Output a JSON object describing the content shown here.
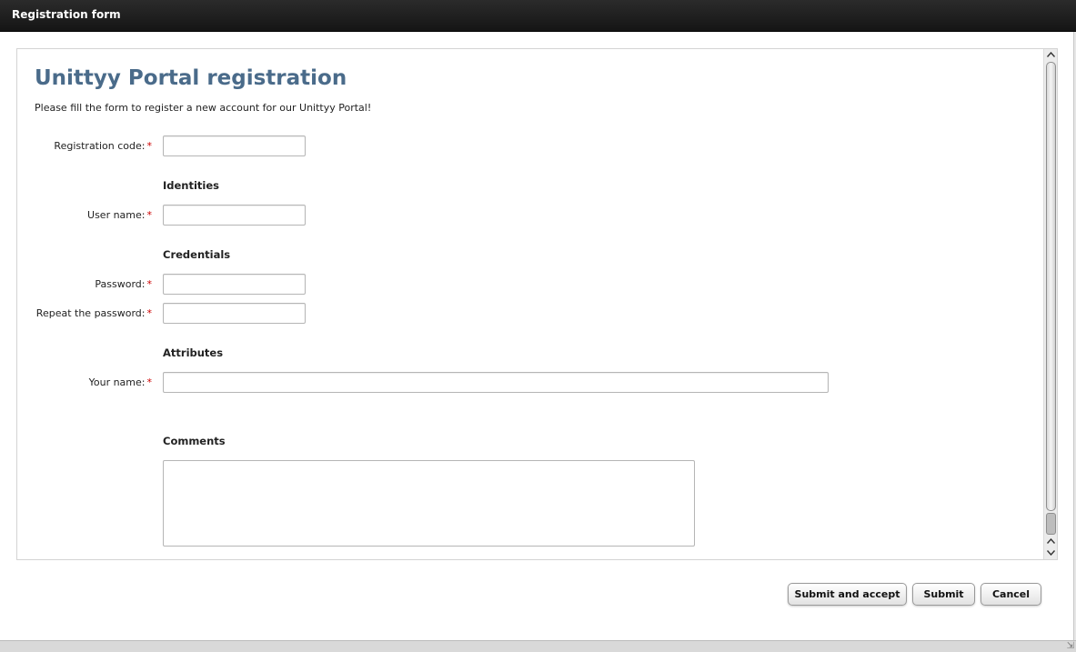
{
  "window": {
    "title": "Registration form"
  },
  "form": {
    "title": "Unittyy Portal registration",
    "intro": "Please fill the form to register a new account for our Unittyy Portal!",
    "required_marker": "*",
    "fields": {
      "registration_code": {
        "label": "Registration code:",
        "value": ""
      },
      "user_name": {
        "label": "User name:",
        "value": ""
      },
      "password": {
        "label": "Password:",
        "value": ""
      },
      "repeat_password": {
        "label": "Repeat the password:",
        "value": ""
      },
      "your_name": {
        "label": "Your name:",
        "value": ""
      },
      "comments": {
        "value": ""
      }
    },
    "sections": {
      "identities": "Identities",
      "credentials": "Credentials",
      "attributes": "Attributes",
      "comments": "Comments"
    }
  },
  "scrollbar": {
    "up_icon": "chevron-up-icon",
    "down_icon": "chevron-down-icon"
  },
  "buttons": {
    "submit_and_accept": "Submit and accept",
    "submit": "Submit",
    "cancel": "Cancel"
  },
  "statusbar": {
    "grip_icon": "resize-grip-icon"
  }
}
